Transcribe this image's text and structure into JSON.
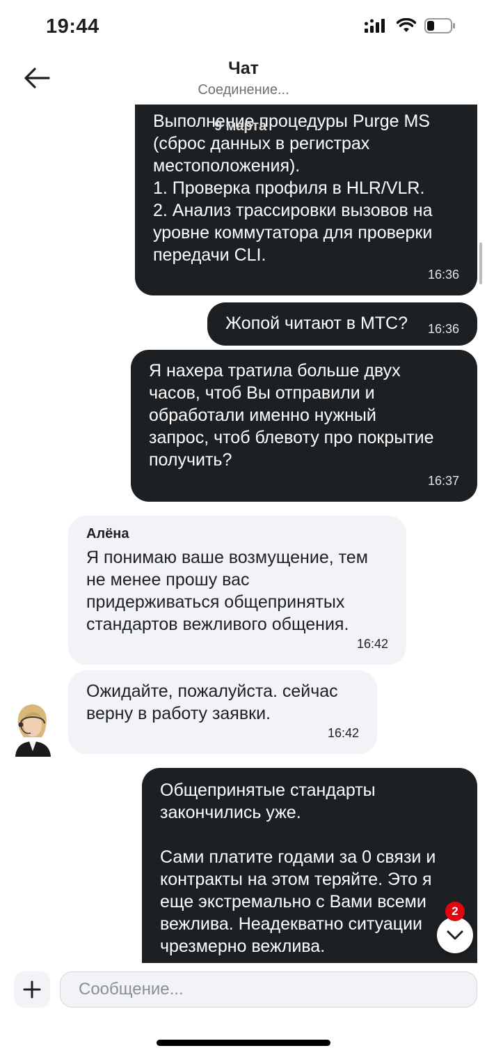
{
  "status_bar": {
    "time": "19:44"
  },
  "header": {
    "title": "Чат",
    "subtitle": "Соединение..."
  },
  "chat": {
    "date_separator": "9 марта",
    "messages": [
      {
        "text": "Выполнение процедуры Purge MS\n(сброс данных в регистрах\nместоположения).\n1. Проверка профиля в HLR/VLR.\n2. Анализ трассировки вызовов на\nуровне коммутатора для проверки\nпередачи CLI.",
        "time": "16:36"
      },
      {
        "text": "Жопой читают в МТС?",
        "time": "16:36"
      },
      {
        "text": "Я нахера тратила больше двух\nчасов, чтоб Вы отправили и\nобработали именно нужный\nзапрос, чтоб блевоту про покрытие\nполучить?",
        "time": "16:37"
      },
      {
        "sender": "Алёна",
        "text": "Я понимаю ваше возмущение, тем\nне менее прошу вас\nпридерживаться общепринятых\nстандартов вежливого общения.",
        "time": "16:42"
      },
      {
        "text": "Ожидайте, пожалуйста. сейчас\nверну в работу заявки.",
        "time": "16:42"
      },
      {
        "text": "Общепринятые стандарты\nзакончились уже.\n\nСами платите годами за 0 связи и\nконтракты на этом теряйте. Это я\nеще экстремально с Вами всеми\nвежлива. Неадекватно ситуации\nчрезмерно вежлива."
      }
    ],
    "unread_count": "2"
  },
  "composer": {
    "placeholder": "Сообщение..."
  },
  "colors": {
    "outgoing_bubble": "#1d2023",
    "incoming_bubble": "#f2f3f7",
    "badge": "#e30611"
  },
  "icons": {
    "back": "arrow-left-icon",
    "scroll_down": "chevron-down-icon",
    "attach": "plus-icon",
    "signal": "cellular-signal-icon",
    "wifi": "wifi-icon",
    "battery": "battery-icon"
  }
}
